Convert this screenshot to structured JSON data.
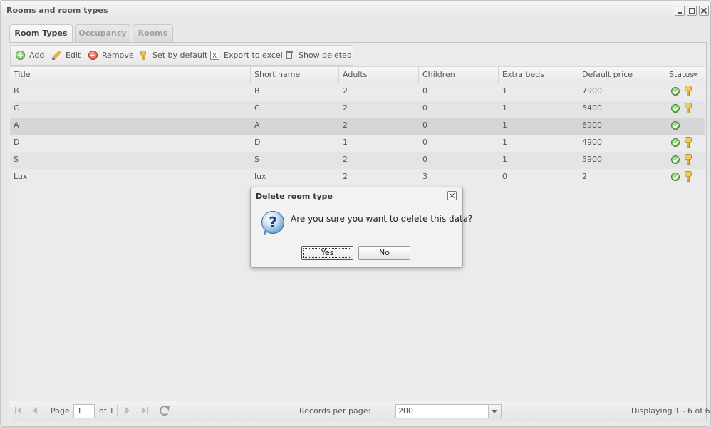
{
  "window": {
    "title": "Rooms and room types"
  },
  "tabs": [
    {
      "label": "Room Types",
      "active": true
    },
    {
      "label": "Occupancy",
      "active": false
    },
    {
      "label": "Rooms",
      "active": false
    }
  ],
  "toolbar": {
    "add": "Add",
    "edit": "Edit",
    "remove": "Remove",
    "set_default": "Set by default",
    "export": "Export to excel",
    "show_deleted": "Show deleted"
  },
  "grid": {
    "columns": [
      "Title",
      "Short name",
      "Adults",
      "Children",
      "Extra beds",
      "Default price",
      "Status"
    ],
    "rows": [
      {
        "title": "B",
        "short": "B",
        "adults": "2",
        "children": "0",
        "extra": "1",
        "price": "7900",
        "active": true,
        "default": true
      },
      {
        "title": "C",
        "short": "C",
        "adults": "2",
        "children": "0",
        "extra": "1",
        "price": "5400",
        "active": true,
        "default": true
      },
      {
        "title": "A",
        "short": "A",
        "adults": "2",
        "children": "0",
        "extra": "1",
        "price": "6900",
        "active": true,
        "default": false
      },
      {
        "title": "D",
        "short": "D",
        "adults": "1",
        "children": "0",
        "extra": "1",
        "price": "4900",
        "active": true,
        "default": true
      },
      {
        "title": "S",
        "short": "S",
        "adults": "2",
        "children": "0",
        "extra": "1",
        "price": "5900",
        "active": true,
        "default": true
      },
      {
        "title": "Lux",
        "short": "lux",
        "adults": "2",
        "children": "3",
        "extra": "0",
        "price": "2",
        "active": true,
        "default": true
      }
    ]
  },
  "pager": {
    "page_label": "Page",
    "page_value": "1",
    "of_label": "of 1",
    "records_label": "Records per page:",
    "records_value": "200",
    "displaying": "Displaying 1 - 6 of 6"
  },
  "dialog": {
    "title": "Delete room type",
    "message": "Are you sure you want to delete this data?",
    "icon": "?",
    "yes": "Yes",
    "no": "No"
  }
}
